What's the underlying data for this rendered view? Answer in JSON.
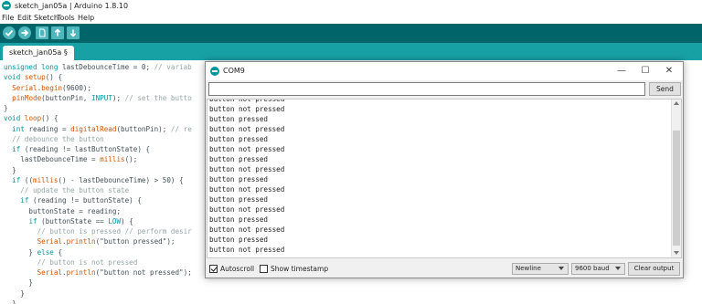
{
  "app": {
    "title": "sketch_jan05a | Arduino 1.8.10"
  },
  "menu": [
    "File",
    "Edit",
    "Sketch",
    "Tools",
    "Help"
  ],
  "toolbar": {
    "buttons": [
      "verify-icon",
      "upload-icon",
      "new-icon",
      "open-icon",
      "save-icon"
    ]
  },
  "tab": {
    "label": "sketch_jan05a §"
  },
  "code": [
    [
      {
        "t": "type",
        "v": "unsigned long"
      },
      {
        "t": "plain",
        "v": " lastDebounceTime = 0; "
      },
      {
        "t": "comment",
        "v": "// variab"
      }
    ],
    [
      {
        "t": "type",
        "v": "void"
      },
      {
        "t": "plain",
        "v": " "
      },
      {
        "t": "fn",
        "v": "setup"
      },
      {
        "t": "plain",
        "v": "() {"
      }
    ],
    [
      {
        "t": "plain",
        "v": "  "
      },
      {
        "t": "fn",
        "v": "Serial"
      },
      {
        "t": "plain",
        "v": "."
      },
      {
        "t": "fn",
        "v": "begin"
      },
      {
        "t": "plain",
        "v": "(9600);"
      }
    ],
    [
      {
        "t": "plain",
        "v": "  "
      },
      {
        "t": "fn",
        "v": "pinMode"
      },
      {
        "t": "plain",
        "v": "(buttonPin, "
      },
      {
        "t": "const",
        "v": "INPUT"
      },
      {
        "t": "plain",
        "v": "); "
      },
      {
        "t": "comment",
        "v": "// set the butto"
      }
    ],
    [
      {
        "t": "plain",
        "v": "}"
      }
    ],
    [
      {
        "t": "type",
        "v": "void"
      },
      {
        "t": "plain",
        "v": " "
      },
      {
        "t": "fn",
        "v": "loop"
      },
      {
        "t": "plain",
        "v": "() {"
      }
    ],
    [
      {
        "t": "plain",
        "v": "  "
      },
      {
        "t": "type",
        "v": "int"
      },
      {
        "t": "plain",
        "v": " reading = "
      },
      {
        "t": "fn",
        "v": "digitalRead"
      },
      {
        "t": "plain",
        "v": "(buttonPin); "
      },
      {
        "t": "comment",
        "v": "// re"
      }
    ],
    [
      {
        "t": "plain",
        "v": "  "
      },
      {
        "t": "comment",
        "v": "// debounce the button"
      }
    ],
    [
      {
        "t": "plain",
        "v": "  "
      },
      {
        "t": "type",
        "v": "if"
      },
      {
        "t": "plain",
        "v": " (reading != lastButtonState) {"
      }
    ],
    [
      {
        "t": "plain",
        "v": "    lastDebounceTime = "
      },
      {
        "t": "fn",
        "v": "millis"
      },
      {
        "t": "plain",
        "v": "();"
      }
    ],
    [
      {
        "t": "plain",
        "v": "  }"
      }
    ],
    [
      {
        "t": "plain",
        "v": "  "
      },
      {
        "t": "type",
        "v": "if"
      },
      {
        "t": "plain",
        "v": " (("
      },
      {
        "t": "fn",
        "v": "millis"
      },
      {
        "t": "plain",
        "v": "() - lastDebounceTime) > 50) {"
      }
    ],
    [
      {
        "t": "plain",
        "v": "    "
      },
      {
        "t": "comment",
        "v": "// update the button state"
      }
    ],
    [
      {
        "t": "plain",
        "v": "    "
      },
      {
        "t": "type",
        "v": "if"
      },
      {
        "t": "plain",
        "v": " (reading != buttonState) {"
      }
    ],
    [
      {
        "t": "plain",
        "v": "      buttonState = reading;"
      }
    ],
    [
      {
        "t": "plain",
        "v": "      "
      },
      {
        "t": "type",
        "v": "if"
      },
      {
        "t": "plain",
        "v": " (buttonState == "
      },
      {
        "t": "const",
        "v": "LOW"
      },
      {
        "t": "plain",
        "v": ") {"
      }
    ],
    [
      {
        "t": "plain",
        "v": "        "
      },
      {
        "t": "comment",
        "v": "// button is pressed // perform desir"
      }
    ],
    [
      {
        "t": "plain",
        "v": "        "
      },
      {
        "t": "fn",
        "v": "Serial"
      },
      {
        "t": "plain",
        "v": "."
      },
      {
        "t": "fn",
        "v": "println"
      },
      {
        "t": "plain",
        "v": "(\"button pressed\");"
      }
    ],
    [
      {
        "t": "plain",
        "v": "      } "
      },
      {
        "t": "type",
        "v": "else"
      },
      {
        "t": "plain",
        "v": " {"
      }
    ],
    [
      {
        "t": "plain",
        "v": "        "
      },
      {
        "t": "comment",
        "v": "// button is not pressed"
      }
    ],
    [
      {
        "t": "plain",
        "v": "        "
      },
      {
        "t": "fn",
        "v": "Serial"
      },
      {
        "t": "plain",
        "v": "."
      },
      {
        "t": "fn",
        "v": "println"
      },
      {
        "t": "plain",
        "v": "(\"button not pressed\");"
      }
    ],
    [
      {
        "t": "plain",
        "v": "      }"
      }
    ],
    [
      {
        "t": "plain",
        "v": "    }"
      }
    ],
    [
      {
        "t": "plain",
        "v": "  }"
      }
    ]
  ],
  "serial": {
    "title": "COM9",
    "input_value": "",
    "send_label": "Send",
    "output_lines": [
      "button not pressed",
      "button not pressed",
      "button pressed",
      "button not pressed",
      "button pressed",
      "button not pressed",
      "button pressed",
      "button not pressed",
      "button pressed",
      "button not pressed",
      "button pressed",
      "button not pressed",
      "button pressed",
      "button not pressed",
      "button pressed",
      "button not pressed"
    ],
    "autoscroll_label": "Autoscroll",
    "autoscroll_checked": true,
    "timestamp_label": "Show timestamp",
    "timestamp_checked": false,
    "line_ending": "Newline",
    "baud": "9600 baud",
    "clear_label": "Clear output"
  },
  "colors": {
    "toolbar": "#006468",
    "tabbar": "#17a1a5",
    "keyword": "#00979c",
    "function": "#d35400",
    "comment": "#95a5a6"
  }
}
